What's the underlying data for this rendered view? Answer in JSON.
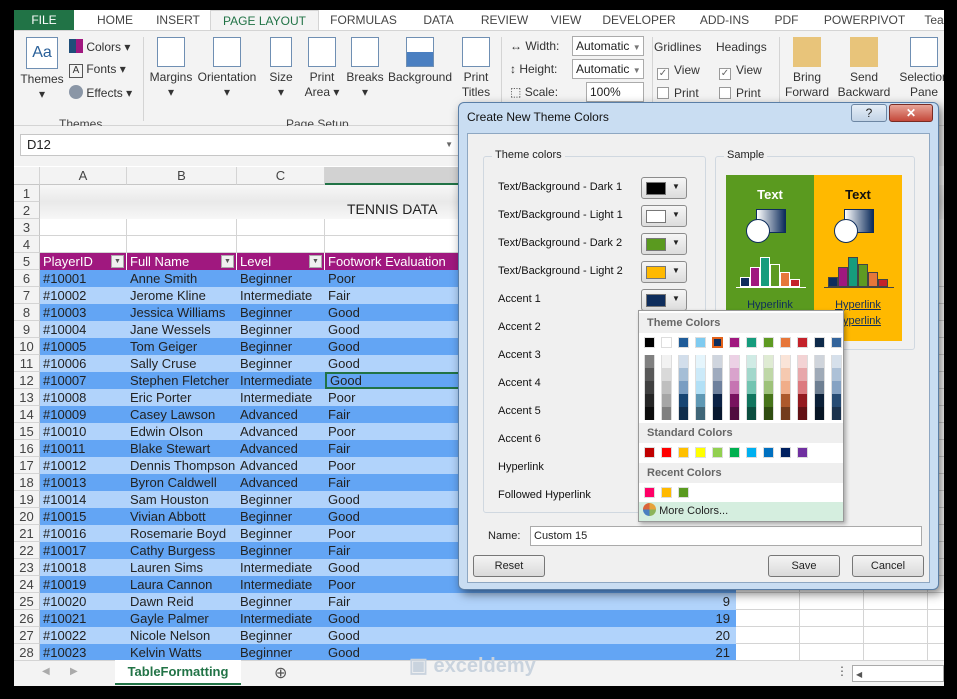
{
  "ribbon": {
    "tabs": [
      "FILE",
      "HOME",
      "INSERT",
      "PAGE LAYOUT",
      "FORMULAS",
      "DATA",
      "REVIEW",
      "VIEW",
      "DEVELOPER",
      "ADD-INS",
      "PDF",
      "POWERPIVOT",
      "Team"
    ],
    "active_tab": "PAGE LAYOUT",
    "themes": {
      "themes": "Themes",
      "colors": "Colors",
      "fonts": "Fonts",
      "effects": "Effects",
      "group": "Themes"
    },
    "page_setup": {
      "margins": "Margins",
      "orientation": "Orientation",
      "size": "Size",
      "print_area_1": "Print",
      "print_area_2": "Area",
      "breaks": "Breaks",
      "background": "Background",
      "print_titles_1": "Print",
      "print_titles_2": "Titles",
      "group": "Page Setup"
    },
    "scale": {
      "width_label": "Width:",
      "width_value": "Automatic",
      "height_label": "Height:",
      "height_value": "Automatic",
      "scale_label": "Scale:",
      "scale_value": "100%"
    },
    "gridlines": {
      "title": "Gridlines",
      "view": "View",
      "print": "Print",
      "view_checked": true,
      "print_checked": false
    },
    "headings": {
      "title": "Headings",
      "view": "View",
      "print": "Print",
      "view_checked": true,
      "print_checked": false
    },
    "arrange": {
      "bring_1": "Bring",
      "bring_2": "Forward",
      "send_1": "Send",
      "send_2": "Backward",
      "sel_1": "Selection",
      "sel_2": "Pane"
    }
  },
  "name_box": "D12",
  "sheet": {
    "columns": [
      "A",
      "B",
      "C",
      "D"
    ],
    "title": "TENNIS DATA",
    "headers": [
      "PlayerID",
      "Full Name",
      "Level",
      "Footwork Evaluation"
    ],
    "rows": [
      [
        "#10001",
        "Anne Smith",
        "Beginner",
        "Poor",
        ""
      ],
      [
        "#10002",
        "Jerome Kline",
        "Intermediate",
        "Fair",
        ""
      ],
      [
        "#10003",
        "Jessica Williams",
        "Beginner",
        "Good",
        ""
      ],
      [
        "#10004",
        "Jane Wessels",
        "Beginner",
        "Good",
        ""
      ],
      [
        "#10005",
        "Tom Geiger",
        "Beginner",
        "Good",
        ""
      ],
      [
        "#10006",
        "Sally Cruse",
        "Beginner",
        "Good",
        ""
      ],
      [
        "#10007",
        "Stephen Fletcher",
        "Intermediate",
        "Good",
        ""
      ],
      [
        "#10008",
        "Eric Porter",
        "Intermediate",
        "Poor",
        ""
      ],
      [
        "#10009",
        "Casey Lawson",
        "Advanced",
        "Fair",
        ""
      ],
      [
        "#10010",
        "Edwin Olson",
        "Advanced",
        "Poor",
        ""
      ],
      [
        "#10011",
        "Blake Stewart",
        "Advanced",
        "Fair",
        ""
      ],
      [
        "#10012",
        "Dennis Thompson",
        "Advanced",
        "Poor",
        ""
      ],
      [
        "#10013",
        "Byron Caldwell",
        "Advanced",
        "Fair",
        ""
      ],
      [
        "#10014",
        "Sam Houston",
        "Beginner",
        "Good",
        ""
      ],
      [
        "#10015",
        "Vivian Abbott",
        "Beginner",
        "Good",
        ""
      ],
      [
        "#10016",
        "Rosemarie Boyd",
        "Beginner",
        "Poor",
        ""
      ],
      [
        "#10017",
        "Cathy Burgess",
        "Beginner",
        "Fair",
        ""
      ],
      [
        "#10018",
        "Lauren Sims",
        "Intermediate",
        "Good",
        ""
      ],
      [
        "#10019",
        "Laura Cannon",
        "Intermediate",
        "Poor",
        ""
      ],
      [
        "#10020",
        "Dawn Reid",
        "Beginner",
        "Fair",
        "9"
      ],
      [
        "#10021",
        "Gayle Palmer",
        "Intermediate",
        "Good",
        "19"
      ],
      [
        "#10022",
        "Nicole Nelson",
        "Beginner",
        "Good",
        "20"
      ],
      [
        "#10023",
        "Kelvin Watts",
        "Beginner",
        "Good",
        "21"
      ]
    ],
    "selected_cell": "D12",
    "sheet_tab": "TableFormatting",
    "watermark": "exceldemy EXCEL · DATA · BI"
  },
  "colors": {
    "header": "#a0187f",
    "row_dark": "#63a5f4",
    "row_light": "#b1d3fb",
    "excel_green": "#217346"
  },
  "dialog": {
    "title": "Create New Theme Colors",
    "theme_colors_label": "Theme colors",
    "sample_label": "Sample",
    "items": [
      {
        "label": "Text/Background - Dark 1",
        "color": "#000000"
      },
      {
        "label": "Text/Background - Light 1",
        "color": "#ffffff"
      },
      {
        "label": "Text/Background - Dark 2",
        "color": "#5a9a1f"
      },
      {
        "label": "Text/Background - Light 2",
        "color": "#ffb900"
      },
      {
        "label": "Accent 1",
        "color": "#0e2d5c"
      },
      {
        "label": "Accent 2"
      },
      {
        "label": "Accent 3"
      },
      {
        "label": "Accent 4"
      },
      {
        "label": "Accent 5"
      },
      {
        "label": "Accent 6"
      },
      {
        "label": "Hyperlink"
      },
      {
        "label": "Followed Hyperlink"
      }
    ],
    "sample": {
      "text": "Text",
      "hyperlink": "Hyperlink",
      "followed": "Hyperlink",
      "bars": [
        "#0e2d5c",
        "#a0187f",
        "#169c7d",
        "#5e9a22",
        "#e6773a",
        "#c4222a"
      ]
    },
    "name_label": "Name:",
    "name_value": "Custom 15",
    "reset": "Reset",
    "save": "Save",
    "cancel": "Cancel"
  },
  "palette": {
    "theme_title": "Theme Colors",
    "theme": [
      "#000000",
      "#ffffff",
      "#1f5c99",
      "#7fcbf0",
      "#0e2d5c",
      "#a0187f",
      "#169c7d",
      "#5e9a22",
      "#e6773a",
      "#c4222a",
      "#0e2a4a",
      "#33649b"
    ],
    "selected": "#0e2d5c",
    "standard_title": "Standard Colors",
    "standard": [
      "#c00000",
      "#ff0000",
      "#ffc000",
      "#ffff00",
      "#92d050",
      "#00b050",
      "#00b0f0",
      "#0070c0",
      "#002060",
      "#7030a0"
    ],
    "recent_title": "Recent Colors",
    "recent": [
      "#ff0066",
      "#ffb900",
      "#5a9a1f"
    ],
    "more": "More Colors..."
  }
}
